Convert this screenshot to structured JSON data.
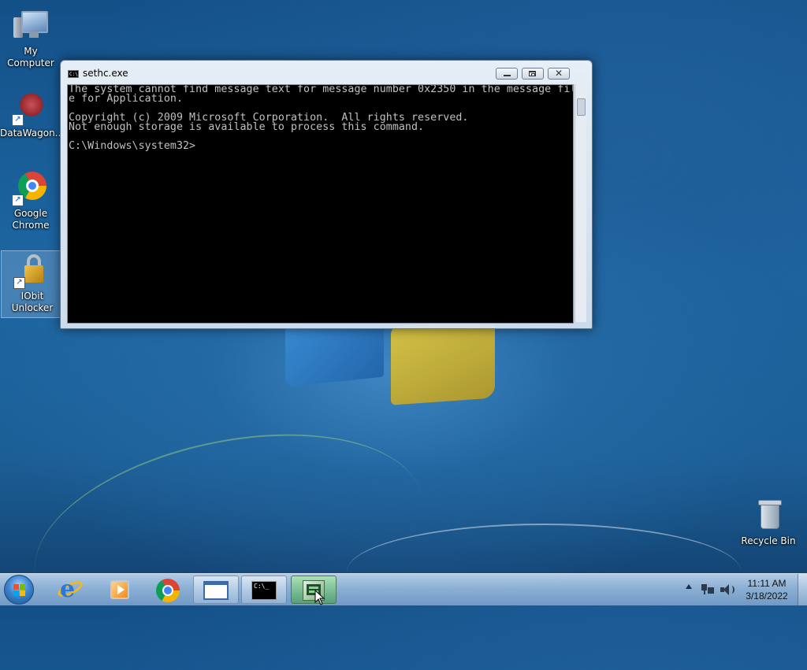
{
  "desktop": {
    "icons": [
      {
        "label": "My Computer",
        "icon": "computer-icon"
      },
      {
        "label": "DataWagon...",
        "icon": "datawagon-icon"
      },
      {
        "label": "Google Chrome",
        "icon": "chrome-icon"
      },
      {
        "label": "IObit Unlocker",
        "icon": "lock-icon"
      },
      {
        "label": "Recycle Bin",
        "icon": "recycle-bin-icon"
      }
    ]
  },
  "console_window": {
    "title": "sethc.exe",
    "icon_text": "C:\\",
    "output": "The system cannot find message text for message number 0x2350 in the message fil\ne for Application.\n\nCopyright (c) 2009 Microsoft Corporation.  All rights reserved.\nNot enough storage is available to process this command.\n\nC:\\Windows\\system32>",
    "close_glyph": "✕"
  },
  "taskbar": {
    "items": [
      {
        "name": "internet-explorer",
        "icon": "ie-icon"
      },
      {
        "name": "media-player",
        "icon": "media-player-icon"
      },
      {
        "name": "google-chrome",
        "icon": "chrome-icon"
      },
      {
        "name": "window-explorer",
        "icon": "window-icon"
      },
      {
        "name": "command-prompt",
        "icon": "cmd-icon",
        "icon_text": "C:\\_"
      },
      {
        "name": "system-config",
        "icon": "config-icon"
      }
    ],
    "clock": {
      "time": "11:11 AM",
      "date": "3/18/2022"
    }
  },
  "colors": {
    "console_bg": "#000000",
    "console_text": "#c0c0c0",
    "desktop_blue": "#1d67a3"
  }
}
